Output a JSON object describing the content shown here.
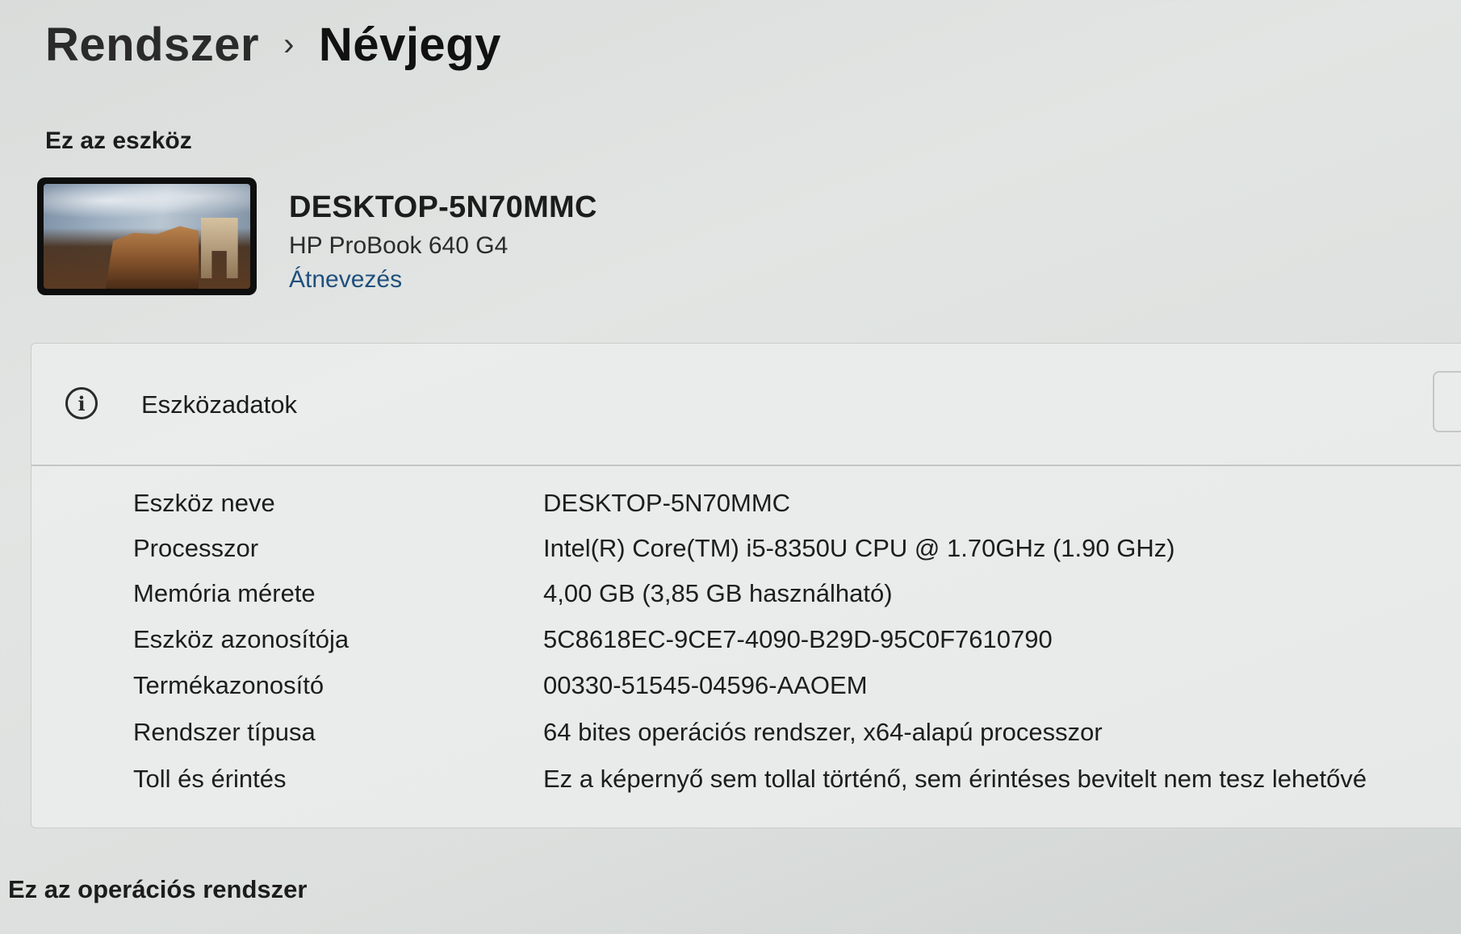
{
  "breadcrumb": {
    "parent": "Rendszer",
    "separator": "›",
    "current": "Névjegy"
  },
  "device_section": {
    "title": "Ez az eszköz",
    "device_name": "DESKTOP-5N70MMC",
    "model": "HP ProBook 640 G4",
    "rename_link": "Átnevezés"
  },
  "device_specs": {
    "title": "Eszközadatok",
    "icon": "info-icon",
    "rows": [
      {
        "label": "Eszköz neve",
        "value": "DESKTOP-5N70MMC"
      },
      {
        "label": "Processzor",
        "value": "Intel(R) Core(TM) i5-8350U CPU @ 1.70GHz (1.90 GHz)"
      },
      {
        "label": "Memória mérete",
        "value": "4,00 GB (3,85 GB használható)"
      },
      {
        "label": "Eszköz azonosítója",
        "value": "5C8618EC-9CE7-4090-B29D-95C0F7610790"
      },
      {
        "label": "Termékazonosító",
        "value": "00330-51545-04596-AAOEM"
      },
      {
        "label": "Rendszer típusa",
        "value": "64 bites operációs rendszer, x64-alapú processzor"
      },
      {
        "label": "Toll és érintés",
        "value": "Ez a képernyő sem tollal történő, sem érintéses bevitelt nem tesz lehetővé"
      }
    ]
  },
  "os_section": {
    "title": "Ez az operációs rendszer"
  },
  "colors": {
    "link": "#1f4f7d",
    "background": "#dcdfdd",
    "card": "#eceeed"
  }
}
